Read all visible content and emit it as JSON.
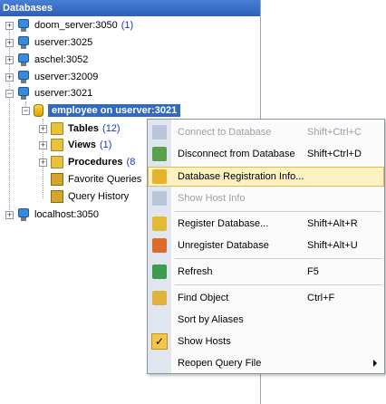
{
  "panel": {
    "title": "Databases"
  },
  "servers": [
    {
      "name": "doom_server:3050",
      "count": "(1)"
    },
    {
      "name": "userver:3025"
    },
    {
      "name": "aschel:3052"
    },
    {
      "name": "userver:32009"
    },
    {
      "name": "userver:3021"
    }
  ],
  "database": {
    "name": "employee on userver:3021"
  },
  "children": [
    {
      "label": "Tables",
      "count": "(12)"
    },
    {
      "label": "Views",
      "count": "(1)"
    },
    {
      "label": "Procedures",
      "count": "(8"
    },
    {
      "label": "Favorite Queries"
    },
    {
      "label": "Query History"
    }
  ],
  "last_server": {
    "name": "localhost:3050"
  },
  "context_menu": {
    "items": [
      {
        "label": "Connect to Database",
        "shortcut": "Shift+Ctrl+C",
        "icon": "connect-icon"
      },
      {
        "label": "Disconnect from Database",
        "shortcut": "Shift+Ctrl+D",
        "icon": "disconnect-icon"
      },
      {
        "label": "Database Registration Info...",
        "shortcut": "",
        "icon": "registration-info-icon"
      },
      {
        "label": "Show Host Info",
        "shortcut": "",
        "icon": "host-info-icon"
      },
      {
        "label": "Register Database...",
        "shortcut": "Shift+Alt+R",
        "icon": "register-icon"
      },
      {
        "label": "Unregister Database",
        "shortcut": "Shift+Alt+U",
        "icon": "unregister-icon"
      },
      {
        "label": "Refresh",
        "shortcut": "F5",
        "icon": "refresh-icon"
      },
      {
        "label": "Find Object",
        "shortcut": "Ctrl+F",
        "icon": "find-icon"
      },
      {
        "label": "Sort by Aliases",
        "shortcut": ""
      },
      {
        "label": "Show Hosts",
        "shortcut": "",
        "icon": "checkmark-icon"
      },
      {
        "label": "Reopen Query File",
        "shortcut": ""
      }
    ]
  },
  "colors": {
    "selection": "#316ac5",
    "menu_highlight": "#fdf0c2",
    "count_text": "#1a37c2"
  }
}
